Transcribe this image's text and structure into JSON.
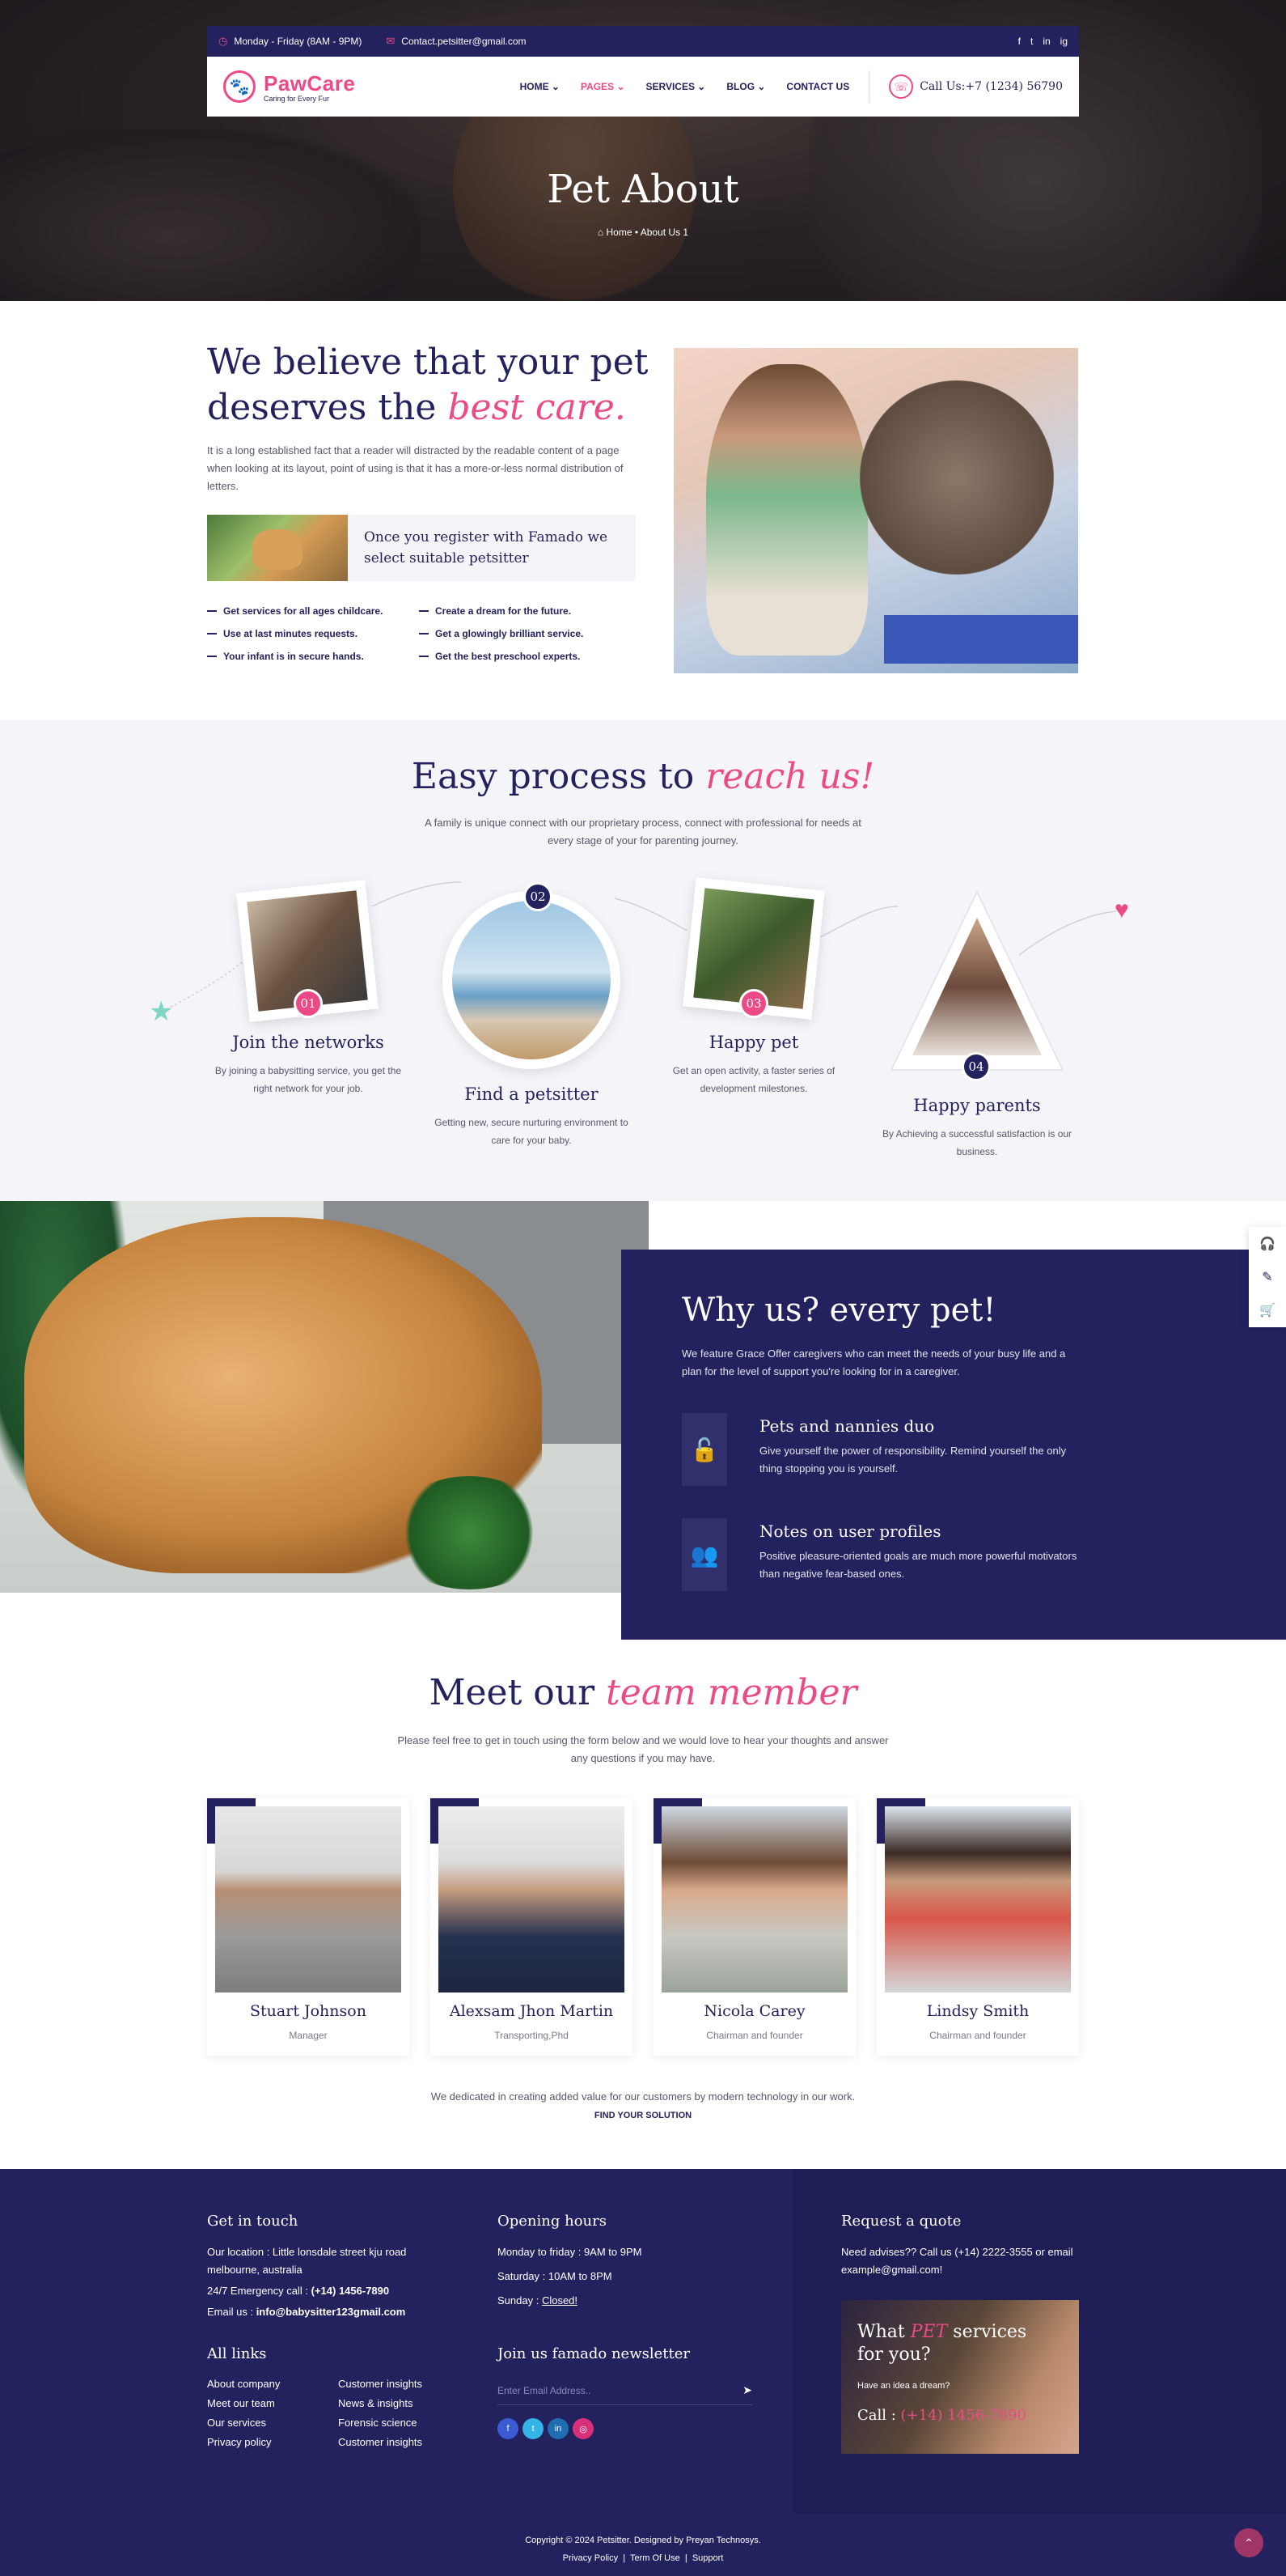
{
  "topbar": {
    "hours": "Monday - Friday (8AM - 9PM)",
    "email": "Contact.petsitter@gmail.com",
    "social": [
      "f",
      "t",
      "in",
      "ig"
    ]
  },
  "logo": {
    "name": "PawCare",
    "tagline": "Caring for Every Fur"
  },
  "nav": {
    "items": [
      "HOME ⌄",
      "PAGES ⌄",
      "SERVICES ⌄",
      "BLOG ⌄",
      "CONTACT US"
    ],
    "call": "Call Us:+7 (1234) 56790"
  },
  "hero": {
    "title": "Pet About",
    "crumb_home": "Home",
    "crumb_current": "About Us 1"
  },
  "about": {
    "title_line1": "We believe that your pet",
    "title_line2": "deserves the ",
    "title_em": "best care.",
    "paragraph": "It is a long established fact that a reader will distracted by the readable content of a page when looking at its layout, point of using is that it has a more-or-less normal distribution of letters.",
    "register": "Once you register with Famado we select suitable petsitter",
    "checks": [
      "Get services for all ages childcare.",
      "Create a dream for the future.",
      "Use at last minutes requests.",
      "Get a glowingly brilliant service.",
      "Your infant is in secure hands.",
      "Get the best preschool experts."
    ]
  },
  "process": {
    "title": "Easy process to ",
    "title_em": "reach us!",
    "paragraph": "A family is unique connect with our proprietary process, connect with professional for needs at every stage of your for parenting journey.",
    "steps": [
      {
        "num": "01",
        "title": "Join the networks",
        "desc": "By joining a babysitting service, you get the right network for your job."
      },
      {
        "num": "02",
        "title": "Find a petsitter",
        "desc": "Getting new, secure nurturing environment to care for your baby."
      },
      {
        "num": "03",
        "title": "Happy pet",
        "desc": "Get an open activity, a faster series of development milestones."
      },
      {
        "num": "04",
        "title": "Happy parents",
        "desc": "By Achieving a successful satisfaction is our business."
      }
    ]
  },
  "why": {
    "title": "Why us? every pet!",
    "paragraph": "We feature Grace Offer caregivers who can meet the needs of your busy life and a plan for the level of support you're looking for in a caregiver.",
    "features": [
      {
        "title": "Pets and nannies duo",
        "desc": "Give yourself the power of responsibility. Remind yourself the only thing stopping you is yourself.",
        "icon": "lock-heart-icon"
      },
      {
        "title": "Notes on user profiles",
        "desc": "Positive pleasure-oriented goals are much more powerful motivators than negative fear-based ones.",
        "icon": "users-icon"
      }
    ]
  },
  "team": {
    "title": "Meet our ",
    "title_em": "team member",
    "paragraph": "Please feel free to get in touch using the form below and we would love to hear your thoughts and answer any questions if you may have.",
    "members": [
      {
        "name": "Stuart Johnson",
        "role": "Manager"
      },
      {
        "name": "Alexsam Jhon Martin",
        "role": "Transporting,Phd"
      },
      {
        "name": "Nicola Carey",
        "role": "Chairman and founder"
      },
      {
        "name": "Lindsy Smith",
        "role": "Chairman and founder"
      }
    ],
    "note": "We dedicated in creating added value for our customers by modern technology in our work.",
    "note_link": "FIND YOUR SOLUTION"
  },
  "footer": {
    "touch_title": "Get in touch",
    "location": "Our location : Little lonsdale street kju road melbourne, australia",
    "emergency_label": "24/7 Emergency call : ",
    "emergency": "(+14) 1456-7890",
    "email_label": "Email us : ",
    "email": "info@babysitter123gmail.com",
    "links_title": "All links",
    "links_col1": [
      "About company",
      "Meet our team",
      "Our services",
      "Privacy policy"
    ],
    "links_col2": [
      "Customer insights",
      "News & insights",
      "Forensic science",
      "Customer insights"
    ],
    "hours_title": "Opening hours",
    "hours": [
      "Monday to friday : 9AM to 9PM",
      "Saturday : 10AM to 8PM",
      "Sunday : "
    ],
    "closed": "Closed!",
    "newsletter_title": "Join us famado newsletter",
    "newsletter_placeholder": "Enter Email Address..",
    "quote_title": "Request a quote",
    "quote_text": "Need advises?? Call us (+14) 2222-3555 or email example@gmail.com!",
    "promo_title_a": "What ",
    "promo_title_em": "PET",
    "promo_title_b": " services for you?",
    "promo_sub": "Have an idea a dream?",
    "promo_call_label": "Call : ",
    "promo_call": "(+14) 1456-7890",
    "copyright": "Copyright © 2024 Petsitter. Designed by Preyan Technosys.",
    "bottom_links": [
      "Privacy Policy",
      "Term Of Use",
      "Support"
    ]
  },
  "colors": {
    "navy": "#23225e",
    "pink": "#ec4a86",
    "light": "#f4f4f9"
  }
}
